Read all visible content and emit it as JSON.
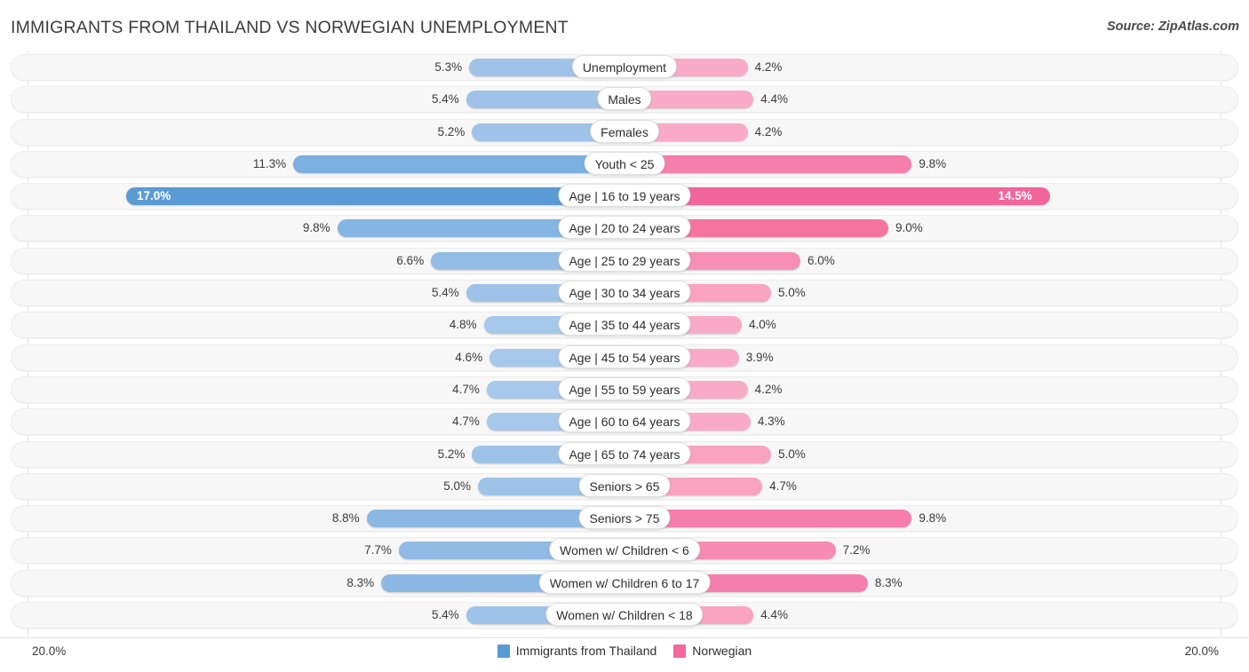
{
  "header": {
    "title": "IMMIGRANTS FROM THAILAND VS NORWEGIAN UNEMPLOYMENT",
    "source": "Source: ZipAtlas.com"
  },
  "legend": {
    "items": [
      {
        "label": "Immigrants from Thailand",
        "color": "#5b9bd5"
      },
      {
        "label": "Norwegian",
        "color": "#f2699c"
      }
    ]
  },
  "axis": {
    "min_label": "20.0%",
    "max_label": "20.0%",
    "max_value": 20.0
  },
  "colors": {
    "left_light": "#9fc3e8",
    "left_dark": "#5b9bd5",
    "right_light": "#f9aac6",
    "right_mid": "#f57eab",
    "right_dark": "#f2659a",
    "track": "#f7f7f7",
    "gridline": "#e2e2e2",
    "text": "#3b3b3b"
  },
  "chart_data": {
    "type": "bar",
    "title": "IMMIGRANTS FROM THAILAND VS NORWEGIAN UNEMPLOYMENT",
    "subtitle": "",
    "xlabel": "",
    "ylabel": "",
    "orientation": "horizontal-diverging",
    "grid": true,
    "legend_position": "bottom-center",
    "axis_max_percent": 20.0,
    "categories": [
      "Unemployment",
      "Males",
      "Females",
      "Youth < 25",
      "Age | 16 to 19 years",
      "Age | 20 to 24 years",
      "Age | 25 to 29 years",
      "Age | 30 to 34 years",
      "Age | 35 to 44 years",
      "Age | 45 to 54 years",
      "Age | 55 to 59 years",
      "Age | 60 to 64 years",
      "Age | 65 to 74 years",
      "Seniors > 65",
      "Seniors > 75",
      "Women w/ Children < 6",
      "Women w/ Children 6 to 17",
      "Women w/ Children < 18"
    ],
    "series": [
      {
        "name": "Immigrants from Thailand",
        "values": [
          5.3,
          5.4,
          5.2,
          11.3,
          17.0,
          9.8,
          6.6,
          5.4,
          4.8,
          4.6,
          4.7,
          4.7,
          5.2,
          5.0,
          8.8,
          7.7,
          8.3,
          5.4
        ]
      },
      {
        "name": "Norwegian",
        "values": [
          4.2,
          4.4,
          4.2,
          9.8,
          14.5,
          9.0,
          6.0,
          5.0,
          4.0,
          3.9,
          4.2,
          4.3,
          5.0,
          4.7,
          9.8,
          7.2,
          8.3,
          4.4
        ]
      }
    ]
  },
  "rows": [
    {
      "label": "Unemployment",
      "left": "5.3%",
      "right": "4.2%",
      "left_val": 5.3,
      "right_val": 4.2,
      "left_color": "#9fc3e8",
      "right_color": "#f9aac6",
      "highlight": false
    },
    {
      "label": "Males",
      "left": "5.4%",
      "right": "4.4%",
      "left_val": 5.4,
      "right_val": 4.4,
      "left_color": "#9fc3e8",
      "right_color": "#f9aac6",
      "highlight": false
    },
    {
      "label": "Females",
      "left": "5.2%",
      "right": "4.2%",
      "left_val": 5.2,
      "right_val": 4.2,
      "left_color": "#9fc3e8",
      "right_color": "#f9aac6",
      "highlight": false
    },
    {
      "label": "Youth < 25",
      "left": "11.3%",
      "right": "9.8%",
      "left_val": 11.3,
      "right_val": 9.8,
      "left_color": "#7cb0e0",
      "right_color": "#f57eab",
      "highlight": false
    },
    {
      "label": "Age | 16 to 19 years",
      "left": "17.0%",
      "right": "14.5%",
      "left_val": 17.0,
      "right_val": 14.5,
      "left_color": "#5b9bd5",
      "right_color": "#f2659a",
      "highlight": true
    },
    {
      "label": "Age | 20 to 24 years",
      "left": "9.8%",
      "right": "9.0%",
      "left_val": 9.8,
      "right_val": 9.0,
      "left_color": "#85b5e2",
      "right_color": "#f5749f",
      "highlight": false
    },
    {
      "label": "Age | 25 to 29 years",
      "left": "6.6%",
      "right": "6.0%",
      "left_val": 6.6,
      "right_val": 6.0,
      "left_color": "#94bde5",
      "right_color": "#f78fb5",
      "highlight": false
    },
    {
      "label": "Age | 30 to 34 years",
      "left": "5.4%",
      "right": "5.0%",
      "left_val": 5.4,
      "right_val": 5.0,
      "left_color": "#9fc3e8",
      "right_color": "#f9a3c0",
      "highlight": false
    },
    {
      "label": "Age | 35 to 44 years",
      "left": "4.8%",
      "right": "4.0%",
      "left_val": 4.8,
      "right_val": 4.0,
      "left_color": "#a6c8ea",
      "right_color": "#f9aac6",
      "highlight": false
    },
    {
      "label": "Age | 45 to 54 years",
      "left": "4.6%",
      "right": "3.9%",
      "left_val": 4.6,
      "right_val": 3.9,
      "left_color": "#a6c8ea",
      "right_color": "#f9aac6",
      "highlight": false
    },
    {
      "label": "Age | 55 to 59 years",
      "left": "4.7%",
      "right": "4.2%",
      "left_val": 4.7,
      "right_val": 4.2,
      "left_color": "#a6c8ea",
      "right_color": "#f9aac6",
      "highlight": false
    },
    {
      "label": "Age | 60 to 64 years",
      "left": "4.7%",
      "right": "4.3%",
      "left_val": 4.7,
      "right_val": 4.3,
      "left_color": "#a6c8ea",
      "right_color": "#f9aac6",
      "highlight": false
    },
    {
      "label": "Age | 65 to 74 years",
      "left": "5.2%",
      "right": "5.0%",
      "left_val": 5.2,
      "right_val": 5.0,
      "left_color": "#9fc3e8",
      "right_color": "#f9a3c0",
      "highlight": false
    },
    {
      "label": "Seniors > 65",
      "left": "5.0%",
      "right": "4.7%",
      "left_val": 5.0,
      "right_val": 4.7,
      "left_color": "#9fc3e8",
      "right_color": "#f9a3c0",
      "highlight": false
    },
    {
      "label": "Seniors > 75",
      "left": "8.8%",
      "right": "9.8%",
      "left_val": 8.8,
      "right_val": 9.8,
      "left_color": "#8cb9e3",
      "right_color": "#f57eab",
      "highlight": false
    },
    {
      "label": "Women w/ Children < 6",
      "left": "7.7%",
      "right": "7.2%",
      "left_val": 7.7,
      "right_val": 7.2,
      "left_color": "#90bbe4",
      "right_color": "#f78cb3",
      "highlight": false
    },
    {
      "label": "Women w/ Children 6 to 17",
      "left": "8.3%",
      "right": "8.3%",
      "left_val": 8.3,
      "right_val": 8.3,
      "left_color": "#8cb9e3",
      "right_color": "#f67eac",
      "highlight": false
    },
    {
      "label": "Women w/ Children < 18",
      "left": "5.4%",
      "right": "4.4%",
      "left_val": 5.4,
      "right_val": 4.4,
      "left_color": "#9fc3e8",
      "right_color": "#f9a3c0",
      "highlight": false
    }
  ]
}
